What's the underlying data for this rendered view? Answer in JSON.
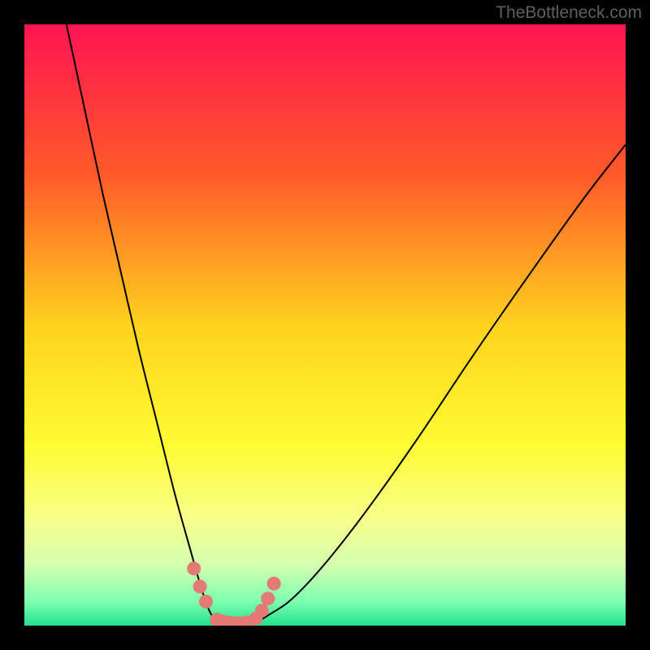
{
  "watermark": "TheBottleneck.com",
  "chart_data": {
    "type": "line",
    "title": "",
    "xlabel": "",
    "ylabel": "",
    "xlim": [
      0,
      100
    ],
    "ylim": [
      0,
      100
    ],
    "series": [
      {
        "name": "curve-left",
        "x": [
          7,
          10,
          13,
          16,
          19,
          22,
          25,
          27.5,
          29.5,
          31,
          32.5,
          34
        ],
        "values": [
          100,
          86,
          72,
          59,
          46,
          34,
          22,
          13,
          6,
          2,
          0.5,
          0
        ]
      },
      {
        "name": "curve-right",
        "x": [
          37,
          39,
          41,
          44,
          48,
          53,
          59,
          66,
          74,
          83,
          93,
          100
        ],
        "values": [
          0,
          0.8,
          2,
          4,
          8,
          14,
          22,
          32,
          44,
          57,
          71,
          80
        ]
      }
    ],
    "highlight_points": [
      {
        "x": 28.2,
        "y": 9.5
      },
      {
        "x": 29.2,
        "y": 6.5
      },
      {
        "x": 30.2,
        "y": 4.0
      },
      {
        "x": 32.0,
        "y": 1.0
      },
      {
        "x": 33.0,
        "y": 0.7
      },
      {
        "x": 34.0,
        "y": 0.5
      },
      {
        "x": 35.0,
        "y": 0.4
      },
      {
        "x": 36.0,
        "y": 0.4
      },
      {
        "x": 37.0,
        "y": 0.5
      },
      {
        "x": 38.5,
        "y": 1.2
      },
      {
        "x": 39.5,
        "y": 2.5
      },
      {
        "x": 40.5,
        "y": 4.5
      },
      {
        "x": 41.5,
        "y": 7.0
      }
    ],
    "gradient_stops": [
      {
        "offset": 0,
        "color": "#ff1452"
      },
      {
        "offset": 0.25,
        "color": "#ff5a2a"
      },
      {
        "offset": 0.5,
        "color": "#ffd21e"
      },
      {
        "offset": 0.7,
        "color": "#fffb33"
      },
      {
        "offset": 0.82,
        "color": "#f8ff8a"
      },
      {
        "offset": 0.9,
        "color": "#d4ffb0"
      },
      {
        "offset": 0.96,
        "color": "#7dffb0"
      },
      {
        "offset": 1.0,
        "color": "#23e08f"
      }
    ],
    "highlight_color": "#e47a74",
    "curve_color": "#000000"
  }
}
